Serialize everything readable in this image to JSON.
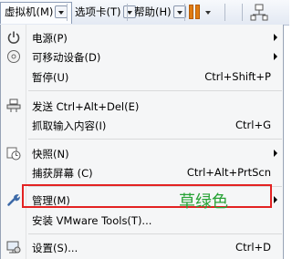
{
  "menubar": {
    "items": [
      {
        "label": "虚拟机(M)"
      },
      {
        "label": "选项卡(T)"
      },
      {
        "label": "帮助(H)"
      }
    ]
  },
  "menu": {
    "items": [
      {
        "label": "电源(P)",
        "shortcut": "",
        "submenu": true,
        "icon": "power-icon"
      },
      {
        "label": "可移动设备(D)",
        "shortcut": "",
        "submenu": true,
        "icon": "disc-icon"
      },
      {
        "label": "暂停(U)",
        "shortcut": "Ctrl+Shift+P",
        "submenu": false,
        "icon": ""
      },
      {
        "label": "发送 Ctrl+Alt+Del(E)",
        "shortcut": "",
        "submenu": false,
        "icon": "send-keys-icon"
      },
      {
        "label": "抓取输入内容(I)",
        "shortcut": "Ctrl+G",
        "submenu": false,
        "icon": ""
      },
      {
        "label": "快照(N)",
        "shortcut": "",
        "submenu": true,
        "icon": "snapshot-clock-icon"
      },
      {
        "label": "捕获屏幕 (C)",
        "shortcut": "Ctrl+Alt+PrtScn",
        "submenu": false,
        "icon": ""
      },
      {
        "label": "管理(M)",
        "shortcut": "",
        "submenu": true,
        "icon": "wrench-icon"
      },
      {
        "label": "安装 VMware Tools(T)...",
        "shortcut": "",
        "submenu": false,
        "icon": ""
      },
      {
        "label": "设置(S)...",
        "shortcut": "Ctrl+D",
        "submenu": false,
        "icon": "settings-monitor-icon"
      }
    ]
  },
  "annotation": {
    "text": "草绿色",
    "color": "#27a235",
    "box_color": "#e32222"
  },
  "colors": {
    "pause_orange": "#e07b10"
  }
}
